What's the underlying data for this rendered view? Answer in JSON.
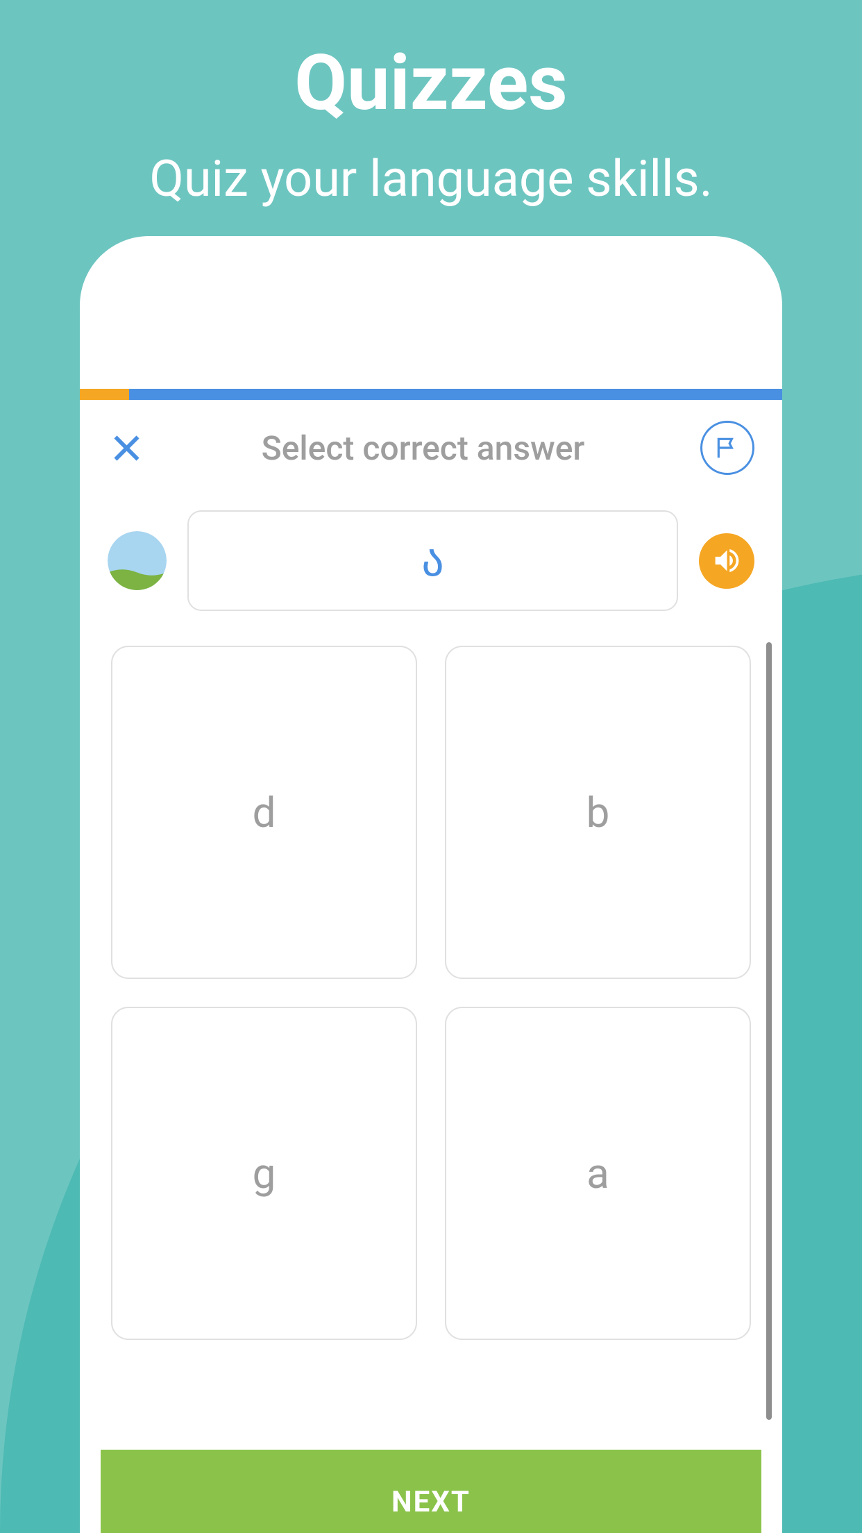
{
  "hero": {
    "title": "Quizzes",
    "subtitle": "Quiz your language skills."
  },
  "progress": {
    "percent": 7
  },
  "quiz": {
    "instruction": "Select correct answer",
    "question_char": "ა",
    "answers": [
      "d",
      "b",
      "g",
      "a"
    ]
  },
  "buttons": {
    "next": "NEXT"
  },
  "colors": {
    "primary_blue": "#4A90E2",
    "accent_orange": "#F5A623",
    "accent_green": "#8BC34A",
    "bg_teal": "#6DC5C0",
    "bg_teal_dark": "#4DBAB3"
  }
}
